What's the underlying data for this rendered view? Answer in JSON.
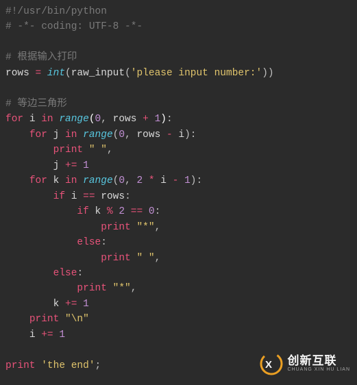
{
  "code": {
    "line1_shebang": "#!/usr/bin/python",
    "line2_coding": "# -*- coding: UTF-8 -*-",
    "line4_comment": "# 根据输入打印",
    "line5": {
      "rows": "rows",
      "eq": "=",
      "int": "int",
      "raw_input": "raw_input",
      "prompt": "'please input number:'"
    },
    "line7_comment": "# 等边三角形",
    "kw_for": "for",
    "kw_in": "in",
    "kw_if": "if",
    "kw_else": "else",
    "kw_print": "print",
    "builtin_range": "range",
    "id_i": "i",
    "id_j": "j",
    "id_k": "k",
    "id_rows": "rows",
    "num0": "0",
    "num1": "1",
    "num2": "2",
    "op_plus": "+",
    "op_minus": "-",
    "op_star": "*",
    "op_mod": "%",
    "op_eqeq": "==",
    "op_pluseq": "+=",
    "str_space": "\" \"",
    "str_star": "\"*\"",
    "str_nl": "\"\\n\"",
    "str_end": "'the end'",
    "semi": ";"
  },
  "logo": {
    "cn": "创新互联",
    "en": "CHUANG XIN HU LIAN"
  }
}
